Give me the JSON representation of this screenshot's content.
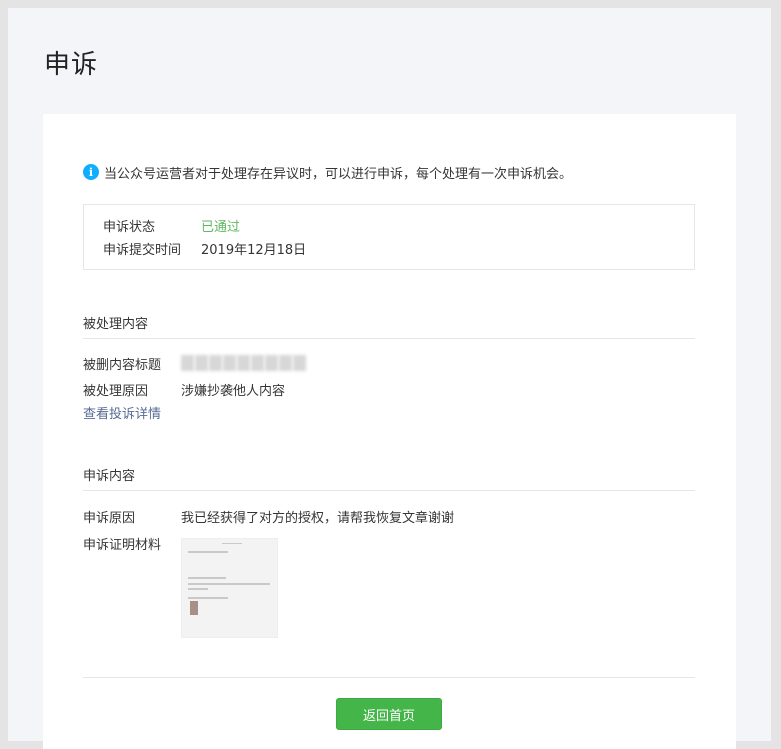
{
  "page": {
    "title": "申诉"
  },
  "notice": {
    "icon": "info-icon",
    "text": "当公众号运营者对于处理存在异议时，可以进行申诉，每个处理有一次申诉机会。"
  },
  "status": {
    "status_label": "申诉状态",
    "status_value": "已通过",
    "time_label": "申诉提交时间",
    "time_value": "2019年12月18日",
    "status_color": "#5fb85f"
  },
  "processed": {
    "section_title": "被处理内容",
    "title_label": "被删内容标题",
    "reason_label": "被处理原因",
    "reason_value": "涉嫌抄袭他人内容",
    "details_link": "查看投诉详情"
  },
  "appeal": {
    "section_title": "申诉内容",
    "reason_label": "申诉原因",
    "reason_value": "我已经获得了对方的授权，请帮我恢复文章谢谢",
    "evidence_label": "申诉证明材料"
  },
  "footer": {
    "back_button": "返回首页",
    "button_color": "#44b549"
  }
}
